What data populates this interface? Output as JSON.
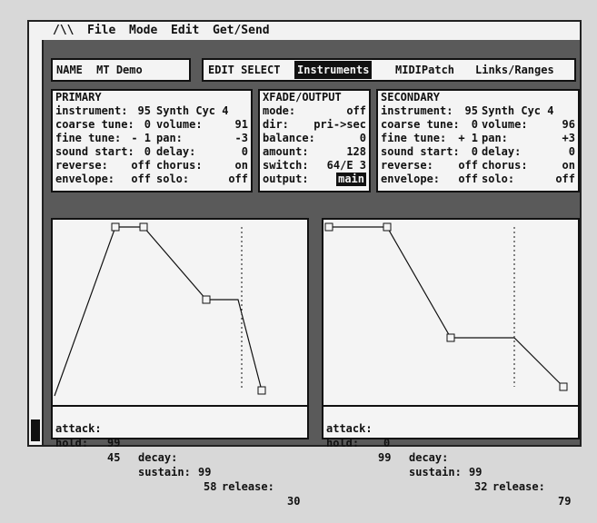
{
  "menu": {
    "logo": "/\\\\",
    "items": [
      "File",
      "Mode",
      "Edit",
      "Get/Send"
    ]
  },
  "name_field": {
    "label": "NAME",
    "value": "MT Demo"
  },
  "edit_select": {
    "label": "EDIT SELECT",
    "tabs": [
      "Instruments",
      "MIDIPatch",
      "Links/Ranges"
    ],
    "selected": "Instruments"
  },
  "primary": {
    "title": "PRIMARY",
    "left": [
      {
        "label": "instrument:",
        "value": "95"
      },
      {
        "label": "coarse tune:",
        "value": "0"
      },
      {
        "label": "fine tune:",
        "value": "- 1"
      },
      {
        "label": "sound start:",
        "value": "0"
      },
      {
        "label": "reverse:",
        "value": "off"
      },
      {
        "label": "envelope:",
        "value": "off"
      }
    ],
    "right": [
      {
        "label": "Synth Cyc 4",
        "value": ""
      },
      {
        "label": "volume:",
        "value": "91"
      },
      {
        "label": "pan:",
        "value": "-3"
      },
      {
        "label": "delay:",
        "value": "0"
      },
      {
        "label": "chorus:",
        "value": "on"
      },
      {
        "label": "solo:",
        "value": "off"
      }
    ]
  },
  "xfade": {
    "title": "XFADE/OUTPUT",
    "rows": [
      {
        "label": "mode:",
        "value": "off"
      },
      {
        "label": "dir:",
        "value": "pri->sec"
      },
      {
        "label": "balance:",
        "value": "0"
      },
      {
        "label": "amount:",
        "value": "128"
      },
      {
        "label": "switch:",
        "value": "64/E 3"
      },
      {
        "label": "output:",
        "value": "main"
      }
    ]
  },
  "secondary": {
    "title": "SECONDARY",
    "left": [
      {
        "label": "instrument:",
        "value": "95"
      },
      {
        "label": "coarse tune:",
        "value": "0"
      },
      {
        "label": "fine tune:",
        "value": "+ 1"
      },
      {
        "label": "sound start:",
        "value": "0"
      },
      {
        "label": "reverse:",
        "value": "off"
      },
      {
        "label": "envelope:",
        "value": "off"
      }
    ],
    "right": [
      {
        "label": "Synth Cyc 4",
        "value": ""
      },
      {
        "label": "volume:",
        "value": "96"
      },
      {
        "label": "pan:",
        "value": "+3"
      },
      {
        "label": "delay:",
        "value": "0"
      },
      {
        "label": "chorus:",
        "value": "on"
      },
      {
        "label": "solo:",
        "value": "off"
      }
    ]
  },
  "env_primary": {
    "attack_label": "attack:",
    "attack": "99",
    "decay_label": "decay:",
    "decay": "99",
    "release_label": "release:",
    "release": "30",
    "hold_label": "hold:",
    "hold": "45",
    "sustain_label": "sustain:",
    "sustain": "58"
  },
  "env_secondary": {
    "attack_label": "attack:",
    "attack": "0",
    "decay_label": "decay:",
    "decay": "99",
    "release_label": "release:",
    "release": "79",
    "hold_label": "hold:",
    "hold": "99",
    "sustain_label": "sustain:",
    "sustain": "32"
  }
}
